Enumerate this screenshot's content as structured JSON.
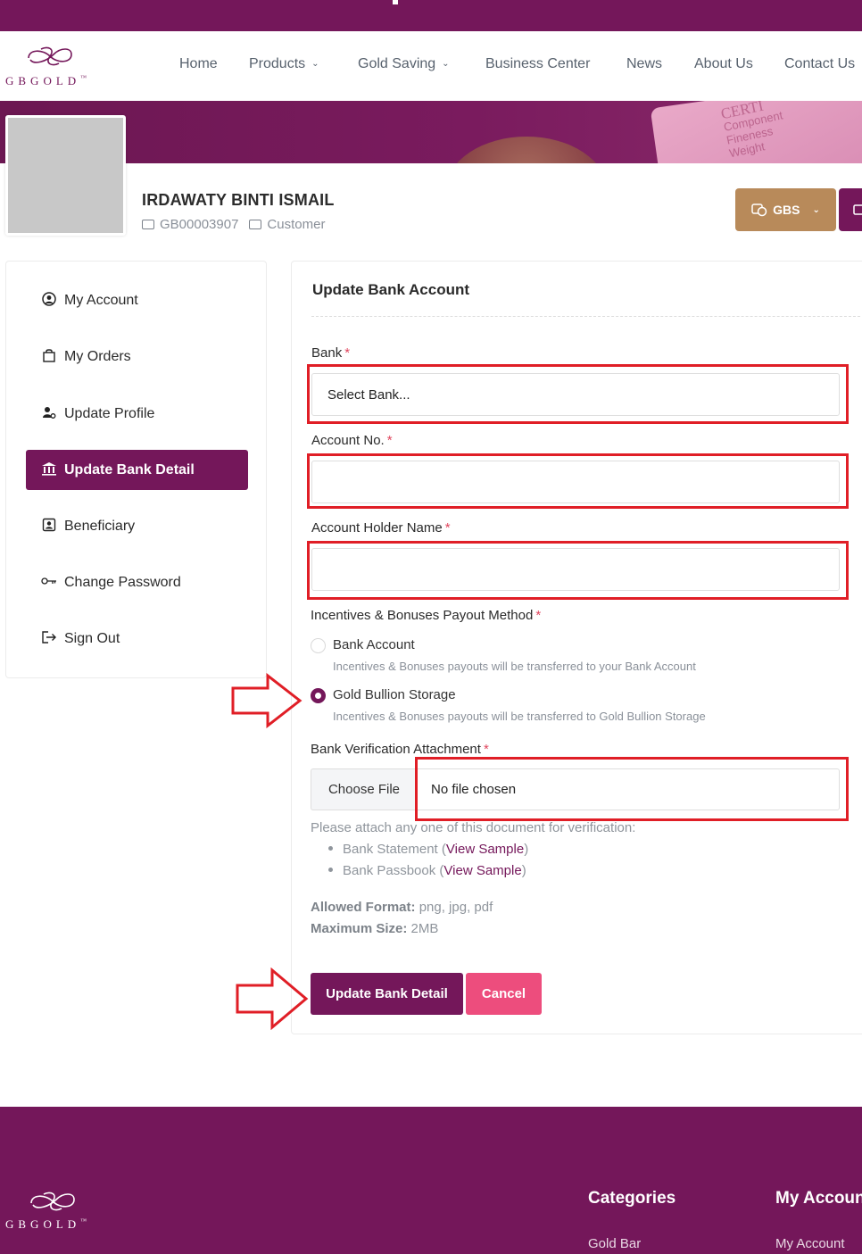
{
  "brand": {
    "wordmark": "GBGOLD",
    "tm": "™"
  },
  "nav": [
    {
      "label": "Home",
      "has_dropdown": false
    },
    {
      "label": "Products",
      "has_dropdown": true
    },
    {
      "label": "Gold Saving",
      "has_dropdown": true
    },
    {
      "label": "Business Center",
      "has_dropdown": false
    },
    {
      "label": "News",
      "has_dropdown": false
    },
    {
      "label": "About Us",
      "has_dropdown": false
    },
    {
      "label": "Contact Us",
      "has_dropdown": false
    }
  ],
  "banner": {
    "card_text": [
      "CERTI",
      "Component",
      "Fineness",
      "Weight"
    ]
  },
  "user": {
    "name": "IRDAWATY BINTI ISMAIL",
    "member_id": "GB00003907",
    "role": "Customer"
  },
  "header_actions": {
    "gbs_label": "GBS"
  },
  "sidebar": {
    "items": [
      {
        "label": "My Account",
        "icon": "user-circle-icon",
        "active": false
      },
      {
        "label": "My Orders",
        "icon": "shopping-bag-icon",
        "active": false
      },
      {
        "label": "Update Profile",
        "icon": "user-gear-icon",
        "active": false
      },
      {
        "label": "Update Bank Detail",
        "icon": "bank-icon",
        "active": true
      },
      {
        "label": "Beneficiary",
        "icon": "id-card-icon",
        "active": false
      },
      {
        "label": "Change Password",
        "icon": "key-icon",
        "active": false
      },
      {
        "label": "Sign Out",
        "icon": "sign-out-icon",
        "active": false
      }
    ]
  },
  "form": {
    "title": "Update Bank Account",
    "bank": {
      "label": "Bank",
      "required_mark": "*",
      "value": "Select Bank..."
    },
    "account_no": {
      "label": "Account No.",
      "required_mark": "*",
      "value": ""
    },
    "holder_name": {
      "label": "Account Holder Name",
      "required_mark": "*",
      "value": ""
    },
    "payout": {
      "label": "Incentives & Bonuses Payout Method",
      "required_mark": "*",
      "options": [
        {
          "label": "Bank Account",
          "help": "Incentives & Bonuses payouts will be transferred to your Bank Account",
          "selected": false
        },
        {
          "label": "Gold Bullion Storage",
          "help": "Incentives & Bonuses payouts will be transferred to Gold Bullion Storage",
          "selected": true
        }
      ]
    },
    "attachment": {
      "label": "Bank Verification Attachment",
      "required_mark": "*",
      "choose_label": "Choose File",
      "file_status": "No file chosen",
      "note": "Please attach any one of this document for verification:",
      "documents": [
        {
          "name": "Bank Statement",
          "link_label": "View Sample"
        },
        {
          "name": "Bank Passbook",
          "link_label": "View Sample"
        }
      ],
      "allowed_format_label": "Allowed Format:",
      "allowed_format_value": "png, jpg, pdf",
      "max_size_label": "Maximum Size:",
      "max_size_value": "2MB"
    },
    "submit_label": "Update Bank Detail",
    "cancel_label": "Cancel"
  },
  "footer": {
    "headings": [
      "Categories",
      "My Account"
    ],
    "links": [
      "Gold Bar",
      "My Account"
    ]
  },
  "colors": {
    "brand": "#74175a",
    "gold": "#b88a5a",
    "cancel": "#ed4d7d",
    "annotation": "#e01e26"
  }
}
